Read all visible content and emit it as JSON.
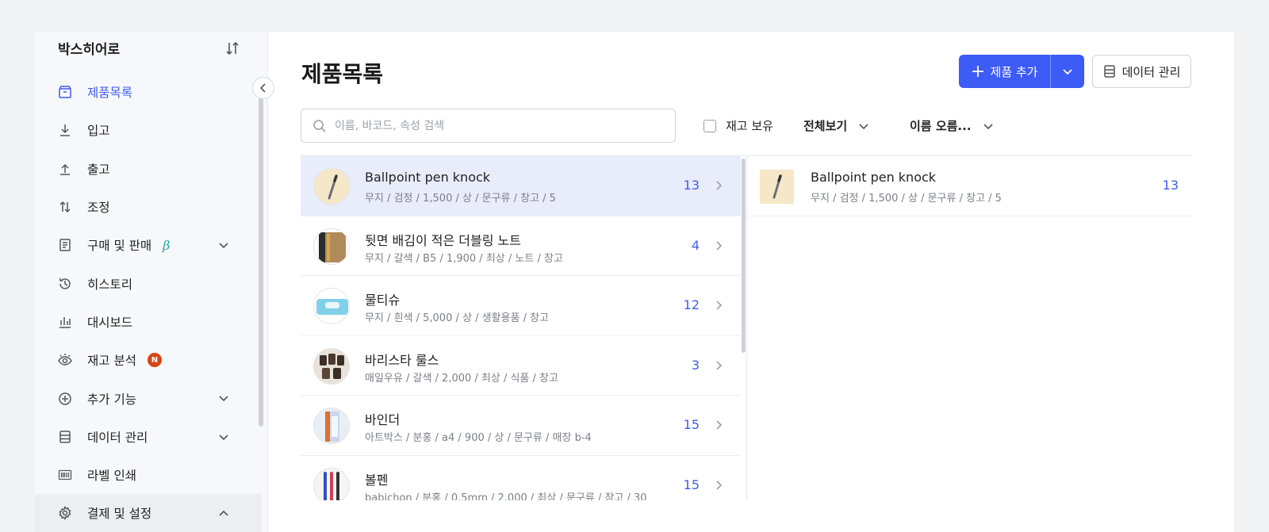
{
  "sidebar": {
    "brand": "박스히어로",
    "items": [
      {
        "label": "제품목록"
      },
      {
        "label": "입고"
      },
      {
        "label": "출고"
      },
      {
        "label": "조정"
      },
      {
        "label": "구매 및 판매",
        "badge": "β"
      },
      {
        "label": "히스토리"
      },
      {
        "label": "대시보드"
      },
      {
        "label": "재고 분석",
        "badge": "N"
      },
      {
        "label": "추가 기능"
      },
      {
        "label": "데이터 관리"
      },
      {
        "label": "라벨 인쇄"
      },
      {
        "label": "결제 및 설정"
      }
    ]
  },
  "header": {
    "title": "제품목록",
    "add_label": "제품 추가",
    "data_label": "데이터 관리"
  },
  "filters": {
    "search_placeholder": "이름, 바코드, 속성 검색",
    "stock_label": "재고 보유",
    "view_label": "전체보기",
    "sort_label": "이름 오름..."
  },
  "products": [
    {
      "name": "Ballpoint pen knock",
      "meta": "무지 / 검정 / 1,500 / 상 / 문구류 / 창고 / 5",
      "qty": "13"
    },
    {
      "name": "뒷면 배김이 적은 더블링 노트",
      "meta": "무지 / 갈색 / B5 / 1,900 / 최상 / 노트 / 창고",
      "qty": "4"
    },
    {
      "name": "물티슈",
      "meta": "무지 / 흰색 / 5,000 / 상 / 생활용품 / 창고",
      "qty": "12"
    },
    {
      "name": "바리스타 룰스",
      "meta": "매일우유 / 갈색 / 2,000 / 최상 / 식품 / 창고",
      "qty": "3"
    },
    {
      "name": "바인더",
      "meta": "아트박스 / 분홍 / a4 / 900 / 상 / 문구류 / 매장 b-4",
      "qty": "15"
    },
    {
      "name": "볼펜",
      "meta": "babichon / 분홍 / 0.5mm / 2,000 / 최상 / 문구류 / 창고 / 30",
      "qty": "15"
    }
  ],
  "detail": {
    "name": "Ballpoint pen knock",
    "meta": "무지 / 검정 / 1,500 / 상 / 문구류 / 창고 / 5",
    "qty": "13"
  },
  "colors": {
    "accent": "#3d5bf5",
    "beta": "#2aa5a0",
    "badge_new": "#d84315"
  }
}
